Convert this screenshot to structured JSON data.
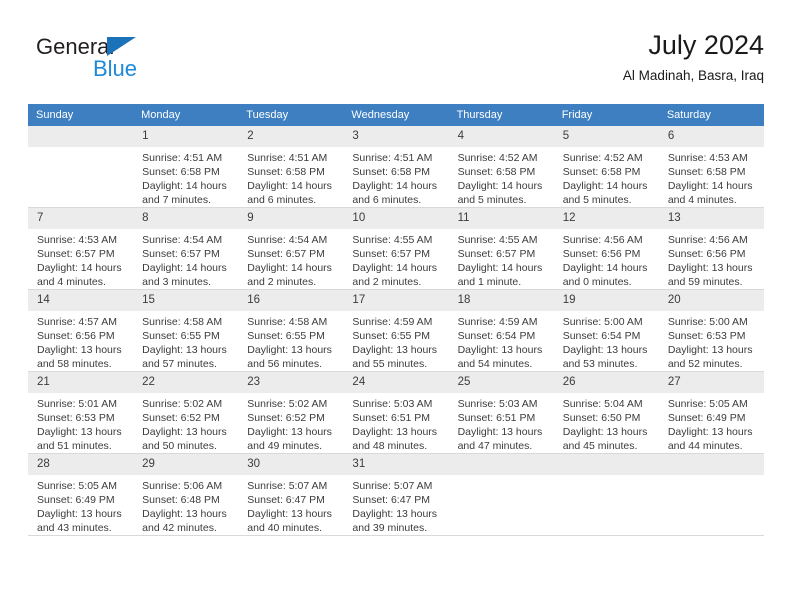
{
  "brand": {
    "word_one": "General",
    "word_two": "Blue",
    "triangle_color": "#1c72b8",
    "blue_color": "#1c8ad6"
  },
  "header": {
    "title": "July 2024",
    "subtitle": "Al Madinah, Basra, Iraq",
    "header_bg": "#3d7fc1",
    "daynum_bg": "#ececec"
  },
  "weekdays": [
    "Sunday",
    "Monday",
    "Tuesday",
    "Wednesday",
    "Thursday",
    "Friday",
    "Saturday"
  ],
  "weeks": [
    [
      {
        "day": "",
        "lines": []
      },
      {
        "day": "1",
        "lines": [
          "Sunrise: 4:51 AM",
          "Sunset: 6:58 PM",
          "Daylight: 14 hours",
          "and 7 minutes."
        ]
      },
      {
        "day": "2",
        "lines": [
          "Sunrise: 4:51 AM",
          "Sunset: 6:58 PM",
          "Daylight: 14 hours",
          "and 6 minutes."
        ]
      },
      {
        "day": "3",
        "lines": [
          "Sunrise: 4:51 AM",
          "Sunset: 6:58 PM",
          "Daylight: 14 hours",
          "and 6 minutes."
        ]
      },
      {
        "day": "4",
        "lines": [
          "Sunrise: 4:52 AM",
          "Sunset: 6:58 PM",
          "Daylight: 14 hours",
          "and 5 minutes."
        ]
      },
      {
        "day": "5",
        "lines": [
          "Sunrise: 4:52 AM",
          "Sunset: 6:58 PM",
          "Daylight: 14 hours",
          "and 5 minutes."
        ]
      },
      {
        "day": "6",
        "lines": [
          "Sunrise: 4:53 AM",
          "Sunset: 6:58 PM",
          "Daylight: 14 hours",
          "and 4 minutes."
        ]
      }
    ],
    [
      {
        "day": "7",
        "lines": [
          "Sunrise: 4:53 AM",
          "Sunset: 6:57 PM",
          "Daylight: 14 hours",
          "and 4 minutes."
        ]
      },
      {
        "day": "8",
        "lines": [
          "Sunrise: 4:54 AM",
          "Sunset: 6:57 PM",
          "Daylight: 14 hours",
          "and 3 minutes."
        ]
      },
      {
        "day": "9",
        "lines": [
          "Sunrise: 4:54 AM",
          "Sunset: 6:57 PM",
          "Daylight: 14 hours",
          "and 2 minutes."
        ]
      },
      {
        "day": "10",
        "lines": [
          "Sunrise: 4:55 AM",
          "Sunset: 6:57 PM",
          "Daylight: 14 hours",
          "and 2 minutes."
        ]
      },
      {
        "day": "11",
        "lines": [
          "Sunrise: 4:55 AM",
          "Sunset: 6:57 PM",
          "Daylight: 14 hours",
          "and 1 minute."
        ]
      },
      {
        "day": "12",
        "lines": [
          "Sunrise: 4:56 AM",
          "Sunset: 6:56 PM",
          "Daylight: 14 hours",
          "and 0 minutes."
        ]
      },
      {
        "day": "13",
        "lines": [
          "Sunrise: 4:56 AM",
          "Sunset: 6:56 PM",
          "Daylight: 13 hours",
          "and 59 minutes."
        ]
      }
    ],
    [
      {
        "day": "14",
        "lines": [
          "Sunrise: 4:57 AM",
          "Sunset: 6:56 PM",
          "Daylight: 13 hours",
          "and 58 minutes."
        ]
      },
      {
        "day": "15",
        "lines": [
          "Sunrise: 4:58 AM",
          "Sunset: 6:55 PM",
          "Daylight: 13 hours",
          "and 57 minutes."
        ]
      },
      {
        "day": "16",
        "lines": [
          "Sunrise: 4:58 AM",
          "Sunset: 6:55 PM",
          "Daylight: 13 hours",
          "and 56 minutes."
        ]
      },
      {
        "day": "17",
        "lines": [
          "Sunrise: 4:59 AM",
          "Sunset: 6:55 PM",
          "Daylight: 13 hours",
          "and 55 minutes."
        ]
      },
      {
        "day": "18",
        "lines": [
          "Sunrise: 4:59 AM",
          "Sunset: 6:54 PM",
          "Daylight: 13 hours",
          "and 54 minutes."
        ]
      },
      {
        "day": "19",
        "lines": [
          "Sunrise: 5:00 AM",
          "Sunset: 6:54 PM",
          "Daylight: 13 hours",
          "and 53 minutes."
        ]
      },
      {
        "day": "20",
        "lines": [
          "Sunrise: 5:00 AM",
          "Sunset: 6:53 PM",
          "Daylight: 13 hours",
          "and 52 minutes."
        ]
      }
    ],
    [
      {
        "day": "21",
        "lines": [
          "Sunrise: 5:01 AM",
          "Sunset: 6:53 PM",
          "Daylight: 13 hours",
          "and 51 minutes."
        ]
      },
      {
        "day": "22",
        "lines": [
          "Sunrise: 5:02 AM",
          "Sunset: 6:52 PM",
          "Daylight: 13 hours",
          "and 50 minutes."
        ]
      },
      {
        "day": "23",
        "lines": [
          "Sunrise: 5:02 AM",
          "Sunset: 6:52 PM",
          "Daylight: 13 hours",
          "and 49 minutes."
        ]
      },
      {
        "day": "24",
        "lines": [
          "Sunrise: 5:03 AM",
          "Sunset: 6:51 PM",
          "Daylight: 13 hours",
          "and 48 minutes."
        ]
      },
      {
        "day": "25",
        "lines": [
          "Sunrise: 5:03 AM",
          "Sunset: 6:51 PM",
          "Daylight: 13 hours",
          "and 47 minutes."
        ]
      },
      {
        "day": "26",
        "lines": [
          "Sunrise: 5:04 AM",
          "Sunset: 6:50 PM",
          "Daylight: 13 hours",
          "and 45 minutes."
        ]
      },
      {
        "day": "27",
        "lines": [
          "Sunrise: 5:05 AM",
          "Sunset: 6:49 PM",
          "Daylight: 13 hours",
          "and 44 minutes."
        ]
      }
    ],
    [
      {
        "day": "28",
        "lines": [
          "Sunrise: 5:05 AM",
          "Sunset: 6:49 PM",
          "Daylight: 13 hours",
          "and 43 minutes."
        ]
      },
      {
        "day": "29",
        "lines": [
          "Sunrise: 5:06 AM",
          "Sunset: 6:48 PM",
          "Daylight: 13 hours",
          "and 42 minutes."
        ]
      },
      {
        "day": "30",
        "lines": [
          "Sunrise: 5:07 AM",
          "Sunset: 6:47 PM",
          "Daylight: 13 hours",
          "and 40 minutes."
        ]
      },
      {
        "day": "31",
        "lines": [
          "Sunrise: 5:07 AM",
          "Sunset: 6:47 PM",
          "Daylight: 13 hours",
          "and 39 minutes."
        ]
      },
      {
        "day": "",
        "lines": []
      },
      {
        "day": "",
        "lines": []
      },
      {
        "day": "",
        "lines": []
      }
    ]
  ]
}
